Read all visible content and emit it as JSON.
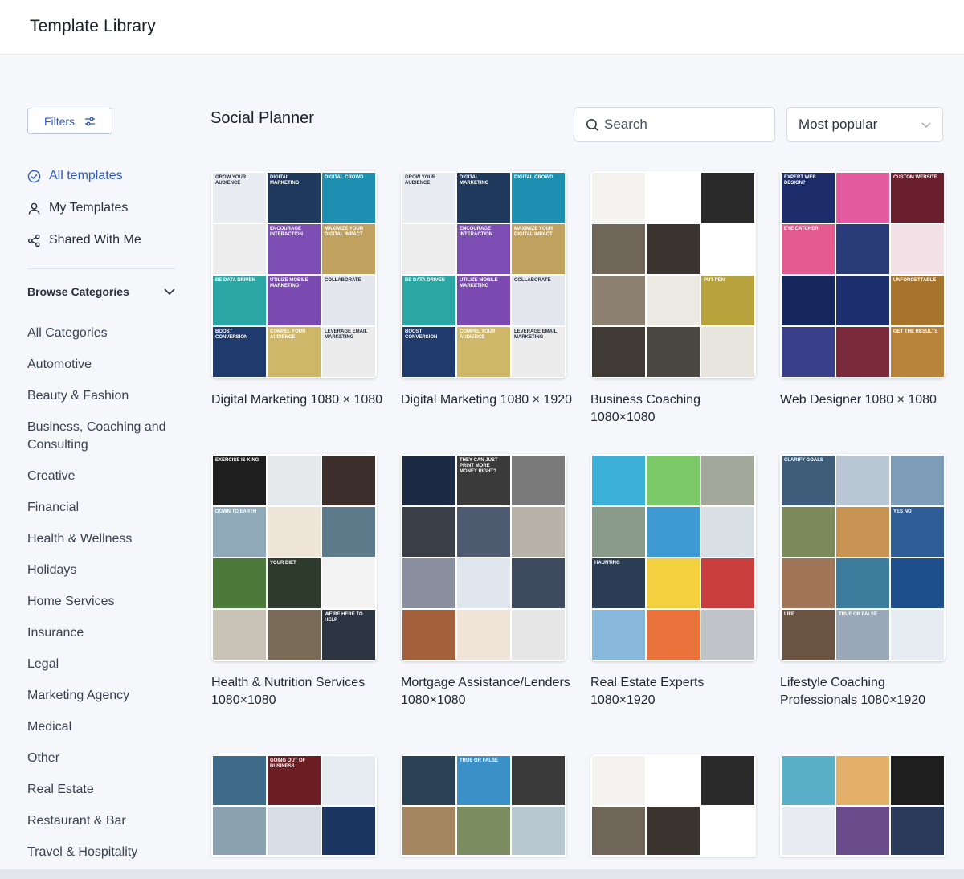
{
  "header": {
    "title": "Template Library"
  },
  "sidebar": {
    "filters_label": "Filters",
    "nav": [
      {
        "label": "All templates",
        "icon": "check-circle-icon",
        "active": true
      },
      {
        "label": "My Templates",
        "icon": "user-icon",
        "active": false
      },
      {
        "label": "Shared With Me",
        "icon": "share-icon",
        "active": false
      }
    ],
    "browse_label": "Browse Categories",
    "categories": [
      "All Categories",
      "Automotive",
      "Beauty & Fashion",
      "Business, Coaching and Consulting",
      "Creative",
      "Financial",
      "Health & Wellness",
      "Holidays",
      "Home Services",
      "Insurance",
      "Legal",
      "Marketing Agency",
      "Medical",
      "Other",
      "Real Estate",
      "Restaurant & Bar",
      "Travel & Hospitality"
    ]
  },
  "main": {
    "section_title": "Social Planner",
    "search_placeholder": "Search",
    "sort_value": "Most popular",
    "cards": [
      {
        "label": "Digital Marketing 1080 × 1080",
        "tile_text": [
          "Grow Your Audience",
          "Digital Marketing",
          "Digital Crowd",
          "",
          "Encourage Interaction",
          "Maximize Your Digital Impact",
          "Be Data Driven",
          "Utilize Mobile Marketing",
          "Collaborate",
          "Boost Conversion",
          "Compel Your Audience",
          "Leverage Email Marketing"
        ],
        "colors": [
          "#e9edf2",
          "#1f3a5c",
          "#1d8fb0",
          "#ededed",
          "#7d4fb4",
          "#c0a25e",
          "#2aa7a5",
          "#7a4ab0",
          "#e4e8ee",
          "#1f3a6c",
          "#cfb76a",
          "#ececec"
        ]
      },
      {
        "label": "Digital Marketing 1080 × 1920",
        "tile_text": [
          "Grow Your Audience",
          "Digital Marketing",
          "Digital Crowd",
          "",
          "Encourage Interaction",
          "Maximize Your Digital Impact",
          "Be Data Driven",
          "Utilize Mobile Marketing",
          "Collaborate",
          "Boost Conversion",
          "Compel Your Audience",
          "Leverage Email Marketing"
        ],
        "colors": [
          "#e9edf2",
          "#1f3a5c",
          "#1d8fb0",
          "#ededed",
          "#7d4fb4",
          "#c0a25e",
          "#2aa7a5",
          "#7a4ab0",
          "#e4e8ee",
          "#1f3a6c",
          "#cfb76a",
          "#ececec"
        ]
      },
      {
        "label": "Business Coaching 1080×1080",
        "tile_text": [
          "",
          "",
          "",
          "",
          "",
          "",
          "",
          "",
          "Put Pen",
          "",
          "",
          ""
        ],
        "colors": [
          "#f4f3ef",
          "#ffffff",
          "#2a2a2a",
          "#6f6558",
          "#3a3530",
          "#ffffff",
          "#8c8170",
          "#ece9e2",
          "#b7a23c",
          "#3f3a34",
          "#4a4640",
          "#e6e4dd"
        ]
      },
      {
        "label": "Web Designer 1080 × 1080",
        "tile_text": [
          "Expert Web Design?",
          "",
          "Custom Website",
          "Eye Catcher",
          "",
          "",
          "",
          "",
          "Unforgettable",
          "",
          "",
          "Get The Results"
        ],
        "colors": [
          "#1d2c6b",
          "#e45ba0",
          "#6a1f2f",
          "#e35a8f",
          "#2a3c7a",
          "#f2e2e8",
          "#16275e",
          "#1d2f6f",
          "#a6742c",
          "#3a3f8a",
          "#7a2a3a",
          "#b8843c"
        ]
      },
      {
        "label": "Health & Nutrition Services 1080×1080",
        "tile_text": [
          "Exercise Is King",
          "",
          "",
          "Down To Earth",
          "",
          "",
          "",
          "Your Diet",
          "",
          "",
          "",
          "We're Here To Help"
        ],
        "colors": [
          "#1e1e1e",
          "#e6e9ec",
          "#3c2f2b",
          "#8fa9b8",
          "#efe6d8",
          "#5c7a8a",
          "#4c7a3a",
          "#2d3a2c",
          "#f3f3f3",
          "#c9c2b6",
          "#7a6a58",
          "#2b3440"
        ]
      },
      {
        "label": "Mortgage Assistance/Lenders 1080×1080",
        "tile_text": [
          "",
          "They Can Just Print More Money Right?",
          "",
          "",
          "",
          "",
          "",
          "",
          "",
          "",
          "",
          ""
        ],
        "colors": [
          "#1c2a44",
          "#3a3a3a",
          "#7a7a7a",
          "#3b3f48",
          "#4d5a70",
          "#b7b2a8",
          "#8a8fa0",
          "#dfe5ec",
          "#3e4a60",
          "#a3603c",
          "#f1e4d8",
          "#e7e7e7"
        ]
      },
      {
        "label": "Real Estate Experts 1080×1920",
        "tile_text": [
          "",
          "",
          "",
          "",
          "",
          "",
          "Haunting",
          "",
          "",
          "",
          "",
          ""
        ],
        "colors": [
          "#3bb0d8",
          "#7cc96a",
          "#a4a89c",
          "#8a9a8a",
          "#3f9ad4",
          "#d8e0e6",
          "#2a3d54",
          "#f3d03e",
          "#c93d3d",
          "#87b8dc",
          "#e9733a",
          "#c0c4c8"
        ]
      },
      {
        "label": "Lifestyle Coaching Professionals 1080×1920",
        "tile_text": [
          "Clarify Goals",
          "",
          "",
          "",
          "",
          "Yes No",
          "",
          "",
          "",
          "Life",
          "True Or False",
          ""
        ],
        "colors": [
          "#3d5d7a",
          "#b9c6d4",
          "#7c9cb8",
          "#7a8a5a",
          "#c89454",
          "#2d5d94",
          "#a07456",
          "#3c7c9c",
          "#1f4e8c",
          "#6b5444",
          "#9aa8b8",
          "#e6ecf2"
        ]
      },
      {
        "label": "",
        "tile_text": [
          "",
          "Going Out Of Business",
          "",
          "",
          "",
          "",
          "",
          "",
          "",
          "",
          "",
          ""
        ],
        "colors": [
          "#3e6b8a",
          "#6b1f24",
          "#e6ecf2",
          "#8aa2b0",
          "#d6dde4",
          "#1a3560",
          "#c7d0d8",
          "#ffffff",
          "#1c2a3e",
          "#e5e9ee",
          "#f4f4f4",
          "#d8dde2"
        ]
      },
      {
        "label": "",
        "tile_text": [
          "",
          "True Or False",
          "",
          "",
          "",
          "",
          "",
          "",
          "",
          "",
          "",
          ""
        ],
        "colors": [
          "#2b4256",
          "#3b90c8",
          "#3a3a3a",
          "#a48660",
          "#7a8c60",
          "#b8c8d0",
          "#d2c8b4",
          "#8a9670",
          "#c0b090",
          "#e0e0e0",
          "#d8d8d8",
          "#cfcfcf"
        ]
      },
      {
        "label": "",
        "tile_text": [
          "",
          "",
          "",
          "",
          "",
          "",
          "",
          "",
          "",
          "",
          "",
          ""
        ],
        "colors": [
          "#f4f3ef",
          "#ffffff",
          "#2a2a2a",
          "#6f6558",
          "#3a3530",
          "#ffffff",
          "#8c8170",
          "#ece9e2",
          "#b7a23c",
          "#3f3a34",
          "#4a4640",
          "#e6e4dd"
        ]
      },
      {
        "label": "",
        "tile_text": [
          "",
          "",
          "",
          "",
          "",
          "",
          "",
          "",
          "",
          "",
          "",
          ""
        ],
        "colors": [
          "#5ab0c8",
          "#e2b068",
          "#1e1e1e",
          "#e8ecf2",
          "#6a4c8c",
          "#2a3a5a",
          "#eef0f4",
          "#c8d0dc",
          "#2a3248",
          "#e0e4ea",
          "#d0d8e2",
          "#2a3244"
        ]
      }
    ]
  },
  "colors": {
    "accent": "#2f5cc2",
    "background": "#f5f7fa"
  }
}
